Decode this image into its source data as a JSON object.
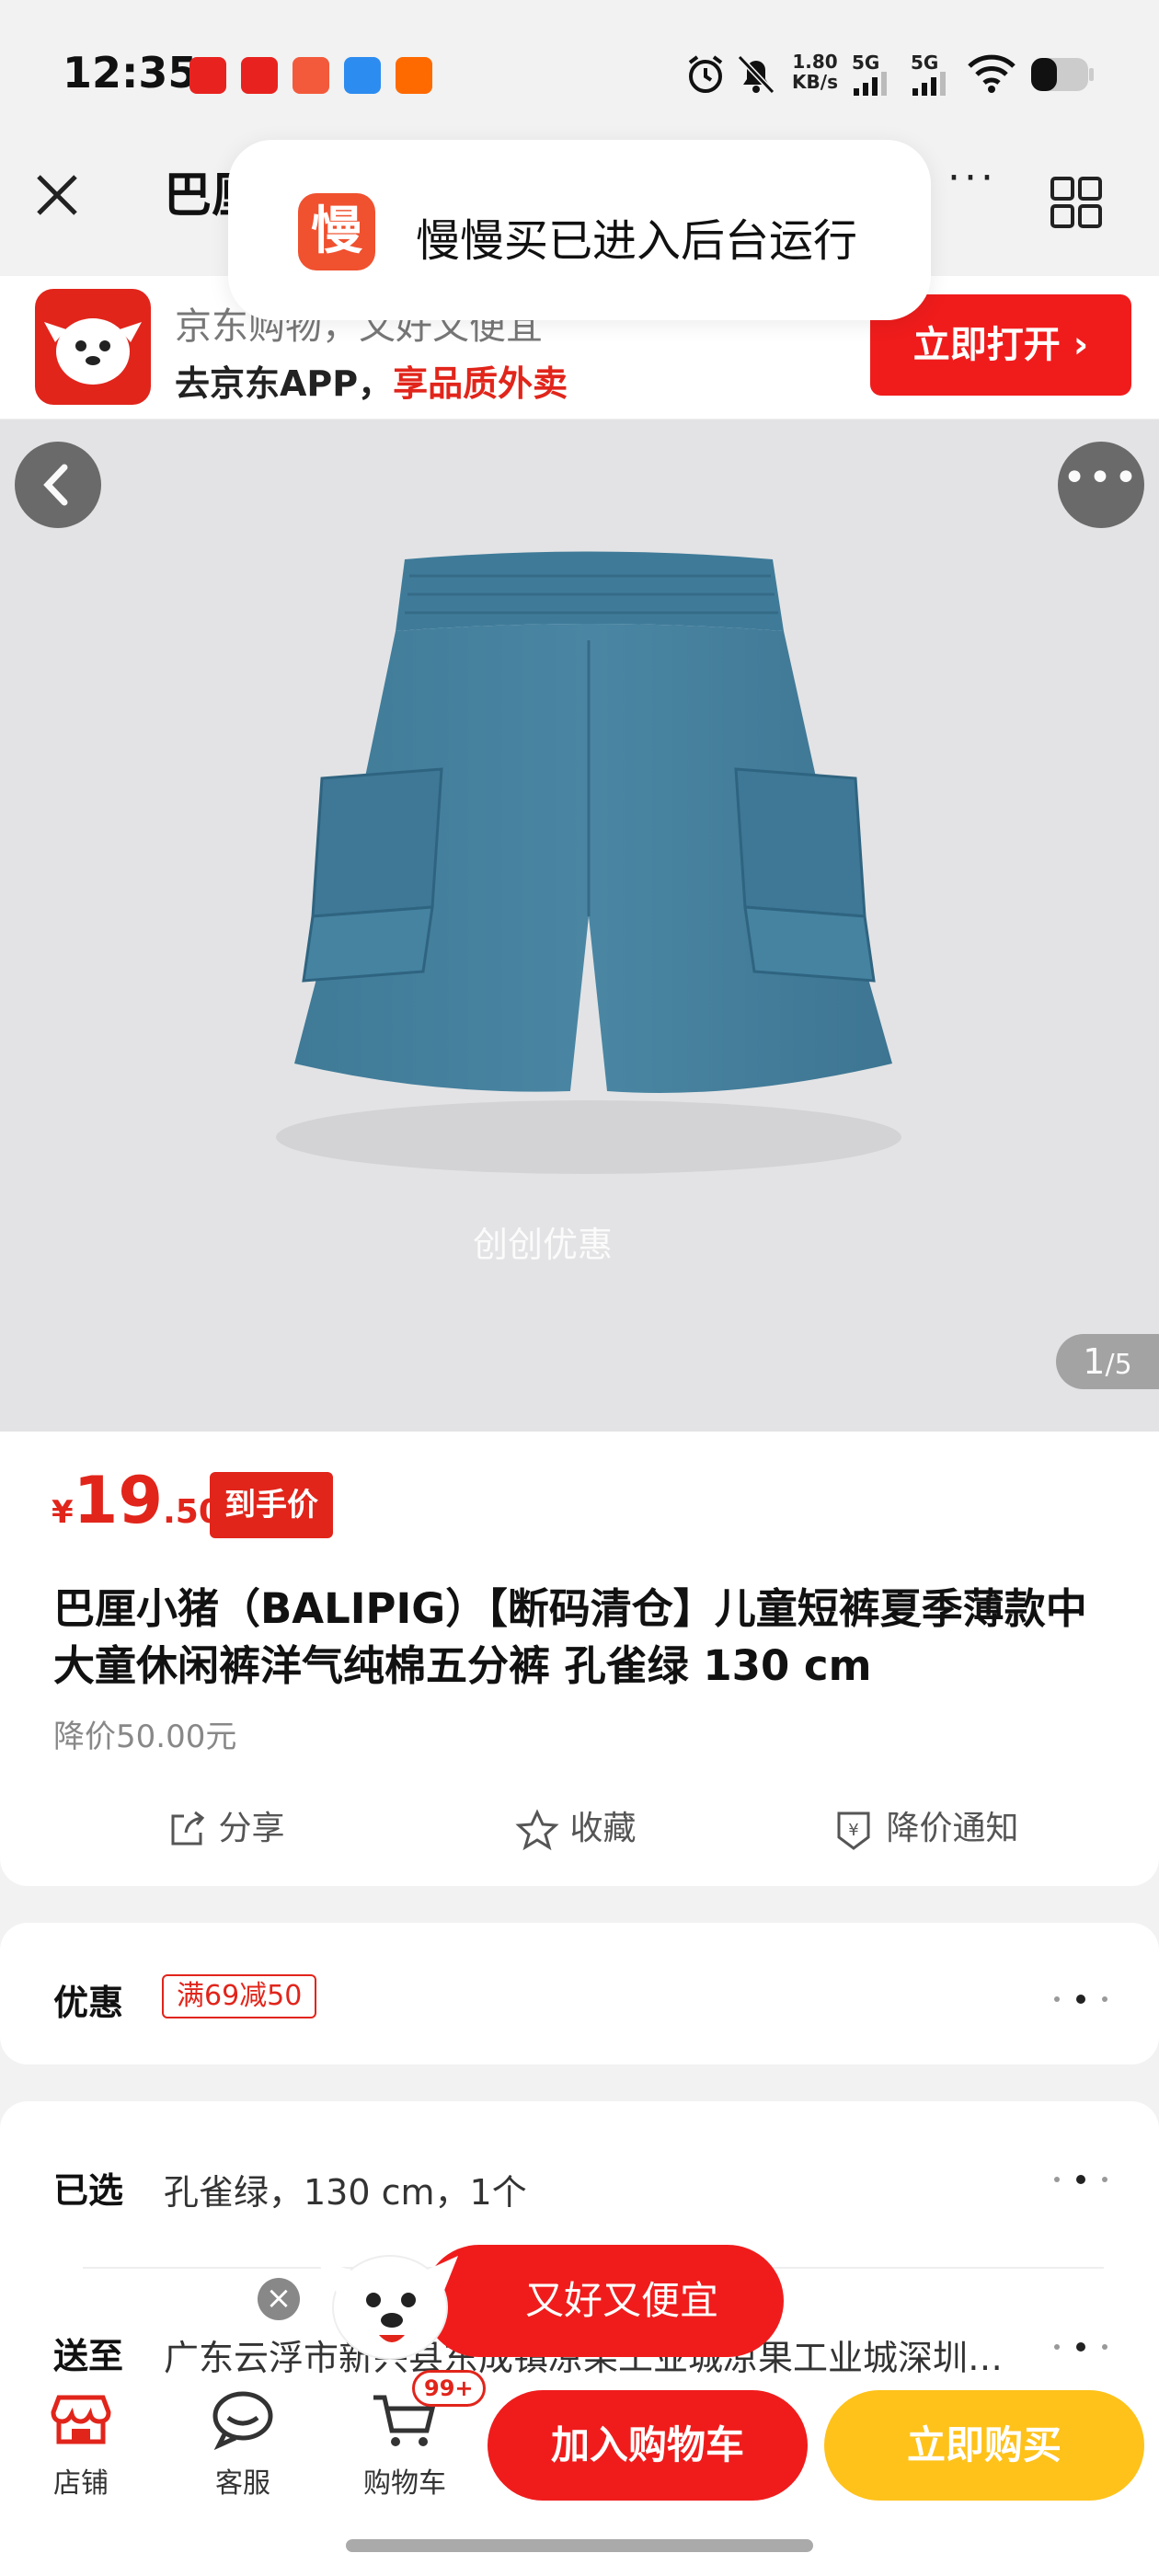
{
  "status_bar": {
    "time": "12:35",
    "net_speed_value": "1.80",
    "net_speed_unit": "KB/s",
    "sim1": "5G",
    "sim2": "5G",
    "app_icons": [
      "app-icon-1",
      "app-icon-2",
      "app-icon-3",
      "app-icon-4",
      "taobao-icon"
    ],
    "status_icons": [
      "alarm-icon",
      "mute-icon",
      "signal-icon",
      "wifi-icon",
      "battery-icon"
    ]
  },
  "nav": {
    "title_visible": "巴厘",
    "more": "···"
  },
  "toast": {
    "icon_char": "慢",
    "text": "慢慢买已进入后台运行"
  },
  "jd_banner": {
    "slogan": "京东购物，又好又便宜",
    "cta_prefix": "去京东APP，",
    "cta_accent": "享品质外卖",
    "open_button": "立即打开"
  },
  "gallery": {
    "watermark": "创创优惠",
    "page_current": "1",
    "page_total": "/5"
  },
  "product": {
    "price_currency": "¥",
    "price_int": "19",
    "price_dec": ".50",
    "price_tag": "到手价",
    "title": "巴厘小猪（BALIPIG）【断码清仓】儿童短裤夏季薄款中大童休闲裤洋气纯棉五分裤 孔雀绿 130 cm",
    "price_drop_note": "降价50.00元",
    "actions": {
      "share": "分享",
      "favorite": "收藏",
      "notify": "降价通知"
    }
  },
  "promo": {
    "label": "优惠",
    "coupon": "满69减50"
  },
  "spec": {
    "selected_label": "已选",
    "selected_value": "孔雀绿，130 cm，1个",
    "ship_label": "送至",
    "ship_value": "广东云浮市新兴县东成镇凉果工业城凉果工业城深圳…"
  },
  "floating": {
    "bubble_text": "又好又便宜",
    "close": "×"
  },
  "bottom_bar": {
    "store": "店铺",
    "service": "客服",
    "cart": "购物车",
    "cart_badge": "99+",
    "add_to_cart": "加入购物车",
    "buy_now": "立即购买"
  },
  "colors": {
    "brand_red": "#e1251b",
    "button_red": "#f01c1c",
    "buy_yellow": "#ffc21a",
    "product_blue": "#4a86a3"
  }
}
